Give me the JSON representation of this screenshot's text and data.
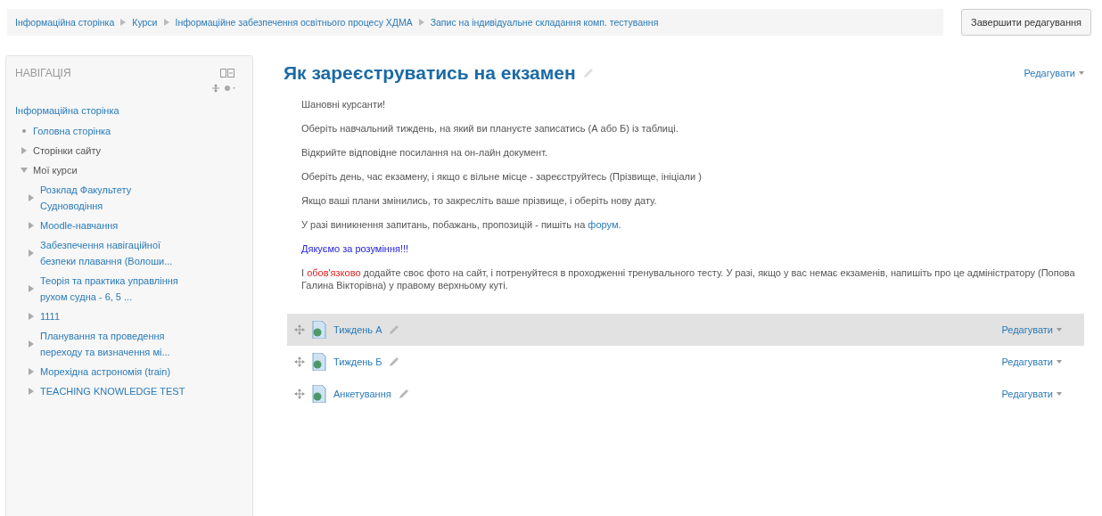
{
  "breadcrumb": [
    "Інформаційна сторінка",
    "Курси",
    "Інформаційне забезпечення освітнього процесу ХДМА",
    "Запис на індивідуальне складання комп. тестування"
  ],
  "finish_button": "Завершити редагування",
  "sidebar": {
    "title": "НАВІГАЦІЯ",
    "root": "Інформаційна сторінка",
    "items": [
      {
        "label": "Головна сторінка",
        "kind": "leaf",
        "link": true
      },
      {
        "label": "Сторінки сайту",
        "kind": "branch",
        "link": false,
        "expanded": false
      },
      {
        "label": "Мої курси",
        "kind": "branch",
        "link": false,
        "expanded": true,
        "children": [
          {
            "label": "Розклад Факультету Судноводіння",
            "kind": "branch",
            "link": true,
            "expanded": false
          },
          {
            "label": "Moodle-навчання",
            "kind": "branch",
            "link": true,
            "expanded": false
          },
          {
            "label": "Забезпечення навігаційної безпеки плавання (Волоши...",
            "kind": "branch",
            "link": true,
            "expanded": false
          },
          {
            "label": "Теорія та практика управління рухом судна - 6, 5 ...",
            "kind": "branch",
            "link": true,
            "expanded": false
          },
          {
            "label": "1111",
            "kind": "branch",
            "link": true,
            "expanded": false
          },
          {
            "label": "Планування та проведення переходу та визначення мі...",
            "kind": "branch",
            "link": true,
            "expanded": false
          },
          {
            "label": "Мореxідна астрономія (train)",
            "kind": "branch",
            "link": true,
            "expanded": false
          },
          {
            "label": "TEACHING KNOWLEDGE TEST",
            "kind": "branch",
            "link": true,
            "expanded": false
          }
        ]
      }
    ]
  },
  "page": {
    "title": "Як зареєструватись на екзамен",
    "edit_menu": "Редагувати",
    "paragraphs": [
      [
        {
          "text": "Шановні курсанти!",
          "kind": "plain"
        }
      ],
      [
        {
          "text": "Оберіть  навчальний тиждень, на який ви плануєте записатись  (А або Б)  із таблиці.",
          "kind": "plain"
        }
      ],
      [
        {
          "text": "Відкрийте відповідне посилання на он-лайн документ.",
          "kind": "plain"
        }
      ],
      [
        {
          "text": "Оберіть день, час екзамену,  і якщо є  вільне місце  - зареєструйтесь (Прізвище, ініціали )",
          "kind": "plain"
        }
      ],
      [
        {
          "text": "Якщо ваші плани змінились, то закресліть ваше прізвище, і оберіть нову дату.",
          "kind": "plain"
        }
      ],
      [
        {
          "text": "У разі виникнення запитань, побажань, пропозицій  - пишіть на ",
          "kind": "plain"
        },
        {
          "text": "форум.",
          "kind": "link"
        }
      ],
      [
        {
          "text": "Дякуємо за розуміння!!!",
          "kind": "accent"
        }
      ],
      [
        {
          "text": "І ",
          "kind": "plain"
        },
        {
          "text": "обов'язково",
          "kind": "warning"
        },
        {
          "text": " додайте своє фото на сайт, і потренуйтеся  в проходженні тренувального тесту. У разі, якщо у вас немає екзаменів, напишіть про це адміністратору (Попова Галина Вікторівна) у правому верхньому куті.",
          "kind": "plain"
        }
      ]
    ],
    "activities": [
      {
        "name": "Тиждень А",
        "edit_menu": "Редагувати",
        "selected": true
      },
      {
        "name": "Тиждень Б",
        "edit_menu": "Редагувати",
        "selected": false
      },
      {
        "name": "Анкетування",
        "edit_menu": "Редагувати",
        "selected": false
      }
    ]
  }
}
